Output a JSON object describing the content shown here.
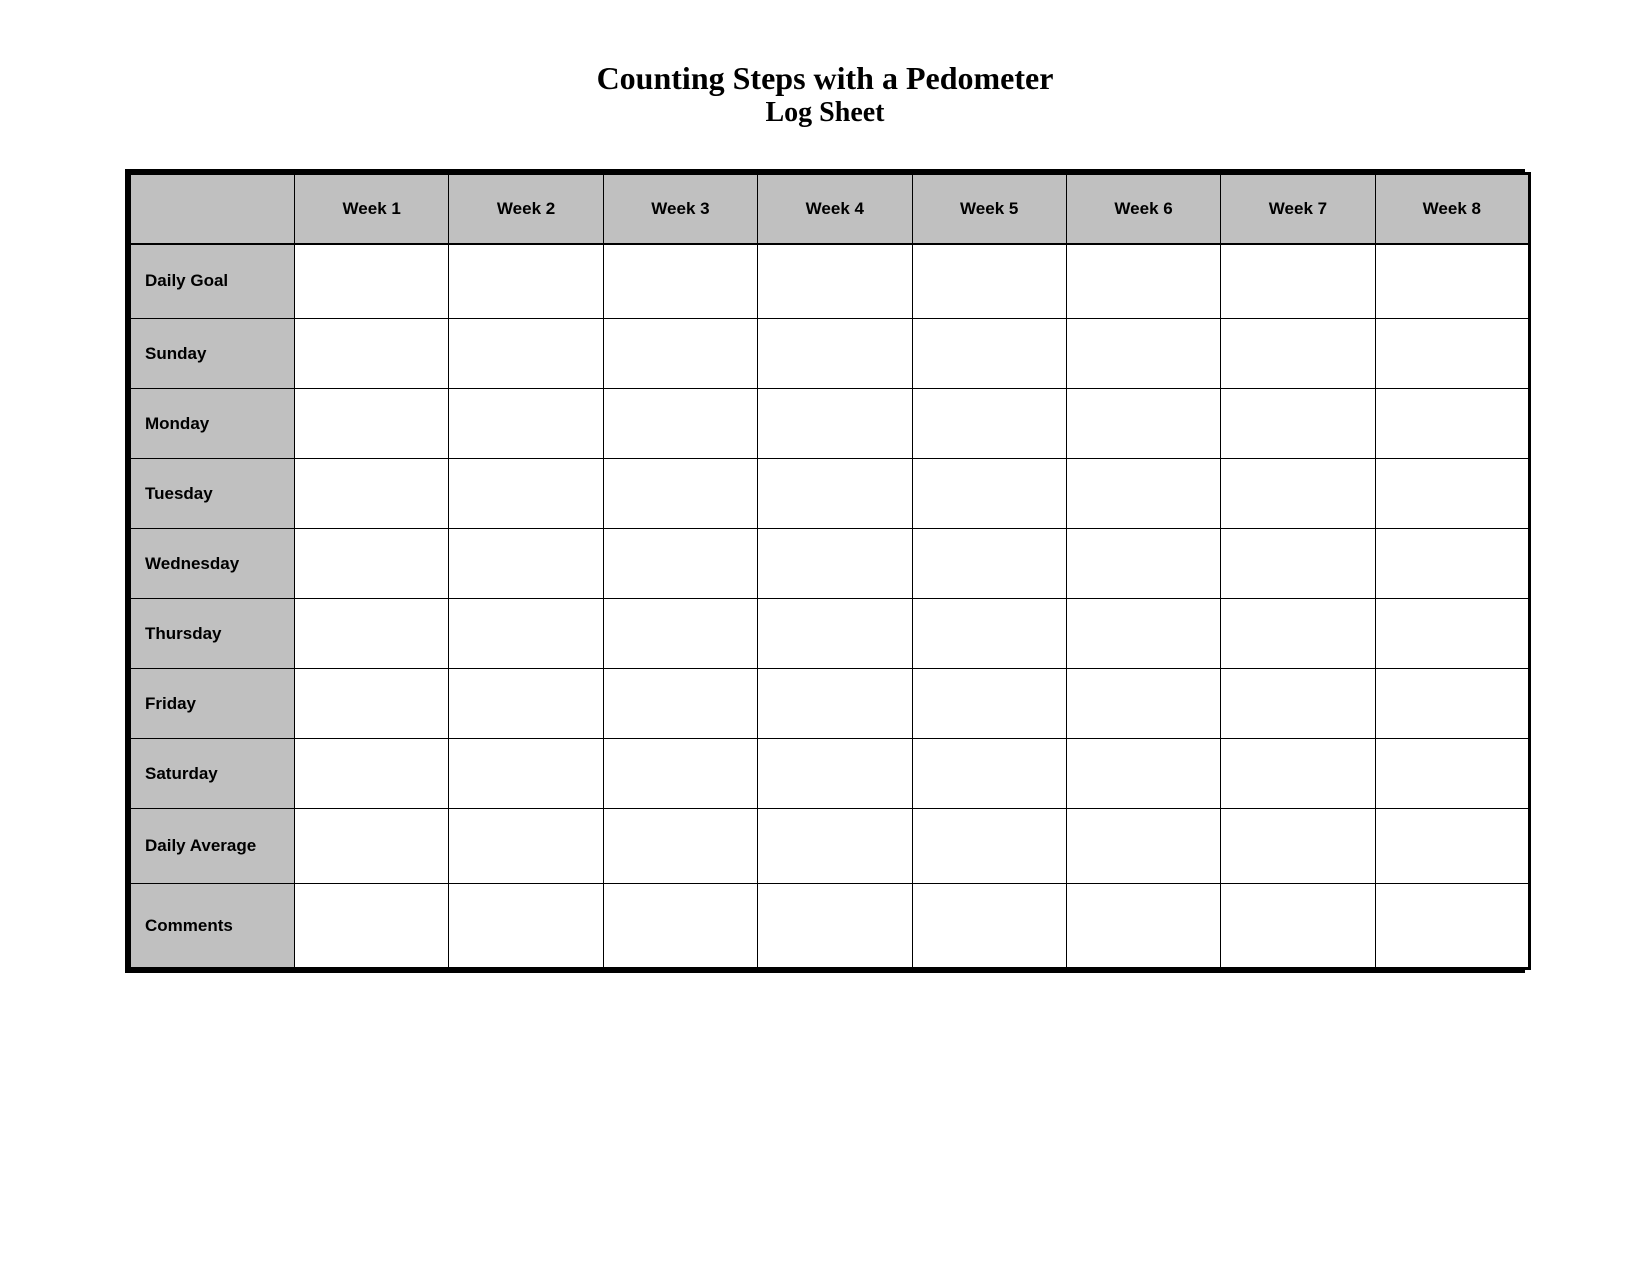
{
  "page": {
    "title_line1": "Counting Steps with a Pedometer",
    "title_line2": "Log Sheet"
  },
  "table": {
    "header": {
      "empty_col": "",
      "weeks": [
        "Week 1",
        "Week 2",
        "Week 3",
        "Week 4",
        "Week 5",
        "Week 6",
        "Week 7",
        "Week 8"
      ]
    },
    "rows": [
      {
        "label": "Daily Goal"
      },
      {
        "label": "Sunday"
      },
      {
        "label": "Monday"
      },
      {
        "label": "Tuesday"
      },
      {
        "label": "Wednesday"
      },
      {
        "label": "Thursday"
      },
      {
        "label": "Friday"
      },
      {
        "label": "Saturday"
      },
      {
        "label": "Daily Average"
      },
      {
        "label": "Comments"
      }
    ]
  }
}
